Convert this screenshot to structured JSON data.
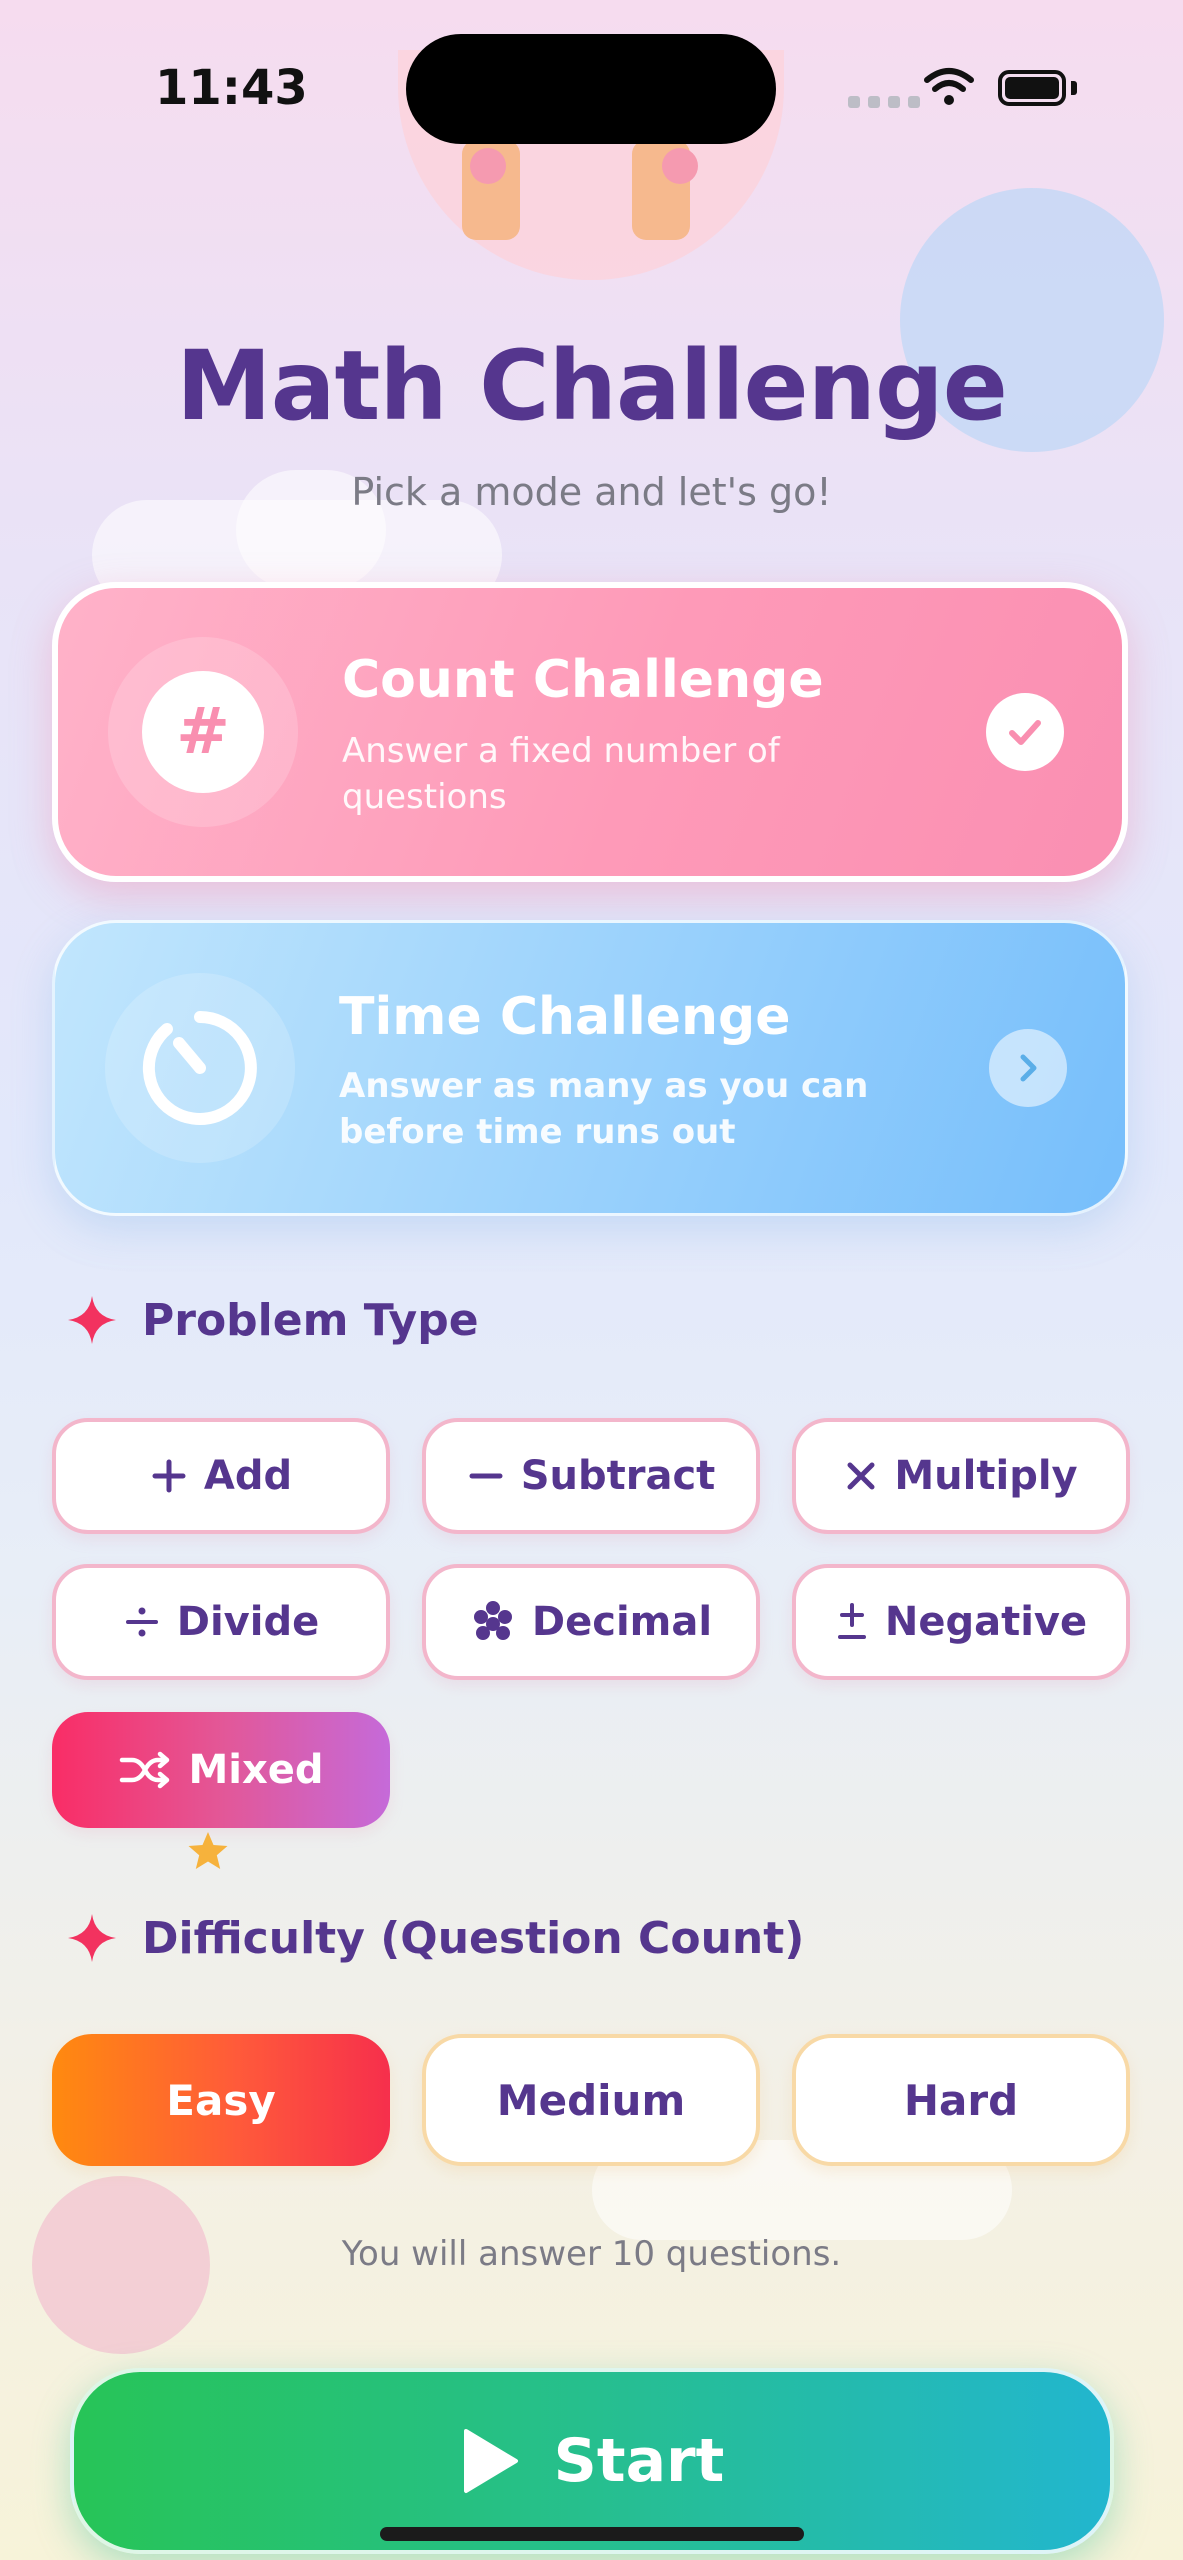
{
  "status_bar": {
    "time": "11:43"
  },
  "header": {
    "title": "Math Challenge",
    "subtitle": "Pick a mode and let's go!"
  },
  "modes": [
    {
      "title": "Count Challenge",
      "description": "Answer a fixed number of questions",
      "icon": "hash-icon",
      "state": "selected",
      "action_icon": "checkmark-icon"
    },
    {
      "title": "Time Challenge",
      "description": "Answer as many as you can before time runs out",
      "icon": "timer-icon",
      "state": "unselected",
      "action_icon": "chevron-right-icon"
    }
  ],
  "problem_type": {
    "heading": "Problem Type",
    "options": [
      {
        "label": "Add",
        "icon": "plus-icon",
        "selected": false
      },
      {
        "label": "Subtract",
        "icon": "minus-icon",
        "selected": false
      },
      {
        "label": "Multiply",
        "icon": "multiply-icon",
        "selected": false
      },
      {
        "label": "Divide",
        "icon": "divide-icon",
        "selected": false
      },
      {
        "label": "Decimal",
        "icon": "decimal-dots-icon",
        "selected": false
      },
      {
        "label": "Negative",
        "icon": "plus-minus-icon",
        "selected": false
      },
      {
        "label": "Mixed",
        "icon": "shuffle-icon",
        "selected": true
      }
    ]
  },
  "difficulty": {
    "heading": "Difficulty (Question Count)",
    "options": [
      {
        "label": "Easy",
        "selected": true
      },
      {
        "label": "Medium",
        "selected": false
      },
      {
        "label": "Hard",
        "selected": false
      }
    ],
    "note": "You will answer 10 questions."
  },
  "start_button": {
    "label": "Start",
    "icon": "play-icon"
  },
  "colors": {
    "title": "#55368e",
    "count_card": "#fe9ab8",
    "time_card": "#9fd4fc",
    "mixed_selected": "#f92d66",
    "easy_selected": "#ff5a3a",
    "start": "#26bf8e",
    "sparkle": "#f2325f",
    "star": "#f6b23c"
  }
}
